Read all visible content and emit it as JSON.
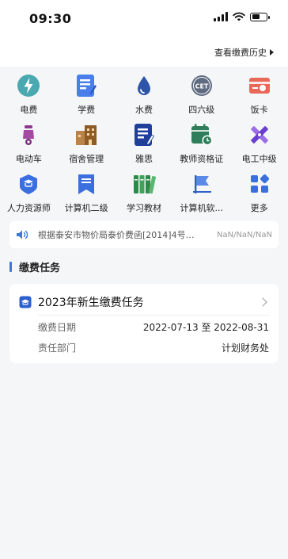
{
  "status": {
    "time": "09:30",
    "battery_level": 0.6
  },
  "header": {
    "history_label": "查看缴费历史"
  },
  "grid": [
    {
      "label": "电费",
      "icon": "lightning-icon",
      "color": "#3aa0a8"
    },
    {
      "label": "学费",
      "icon": "document-edit-icon",
      "color": "#3b6fe0"
    },
    {
      "label": "水费",
      "icon": "water-drop-icon",
      "color": "#2a4fa8"
    },
    {
      "label": "四六级",
      "icon": "cet-badge-icon",
      "color": "#6a7488"
    },
    {
      "label": "饭卡",
      "icon": "meal-card-icon",
      "color": "#e06a5a"
    },
    {
      "label": "电动车",
      "icon": "scooter-icon",
      "color": "#8a3a8a"
    },
    {
      "label": "宿舍管理",
      "icon": "dormitory-icon",
      "color": "#a56a2a"
    },
    {
      "label": "雅思",
      "icon": "ielts-edit-icon",
      "color": "#1f3f9a"
    },
    {
      "label": "教师资格证",
      "icon": "calendar-clock-icon",
      "color": "#2f7d5a"
    },
    {
      "label": "电工中级",
      "icon": "pencil-ruler-icon",
      "color": "#7a4fd8"
    },
    {
      "label": "人力资源师",
      "icon": "graduation-cap-icon",
      "color": "#3b6fe0"
    },
    {
      "label": "计算机二级",
      "icon": "bookmark-icon",
      "color": "#3b6fe0"
    },
    {
      "label": "学习教材",
      "icon": "books-icon",
      "color": "#2f8a4a"
    },
    {
      "label": "计算机软...",
      "icon": "flag-icon",
      "color": "#4a7ae0"
    },
    {
      "label": "更多",
      "icon": "grid-more-icon",
      "color": "#3b6fe0"
    }
  ],
  "notice": {
    "text": "根据泰安市物价局泰价费函[2014]4号文...",
    "date": "NaN/NaN/NaN"
  },
  "section": {
    "title": "缴费任务"
  },
  "task": {
    "title": "2023年新生缴费任务",
    "date_label": "缴费日期",
    "date_value": "2022-07-13 至 2022-08-31",
    "dept_label": "责任部门",
    "dept_value": "计划财务处"
  },
  "colors": {
    "accent": "#3a7bd5",
    "background": "#f5f6f8"
  }
}
